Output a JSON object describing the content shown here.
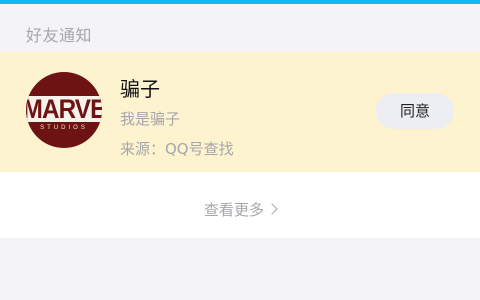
{
  "section": {
    "title": "好友通知"
  },
  "request": {
    "avatar_logo_text": "MARVEL",
    "avatar_logo_sub": "STUDIOS",
    "name": "骗子",
    "message": "我是骗子",
    "source": "来源：QQ号查找",
    "accept_label": "同意"
  },
  "footer": {
    "more_label": "查看更多"
  },
  "colors": {
    "accent_strip": "#12b7f5",
    "card_highlight": "#fdf3cf",
    "avatar_red": "#6e1314"
  }
}
